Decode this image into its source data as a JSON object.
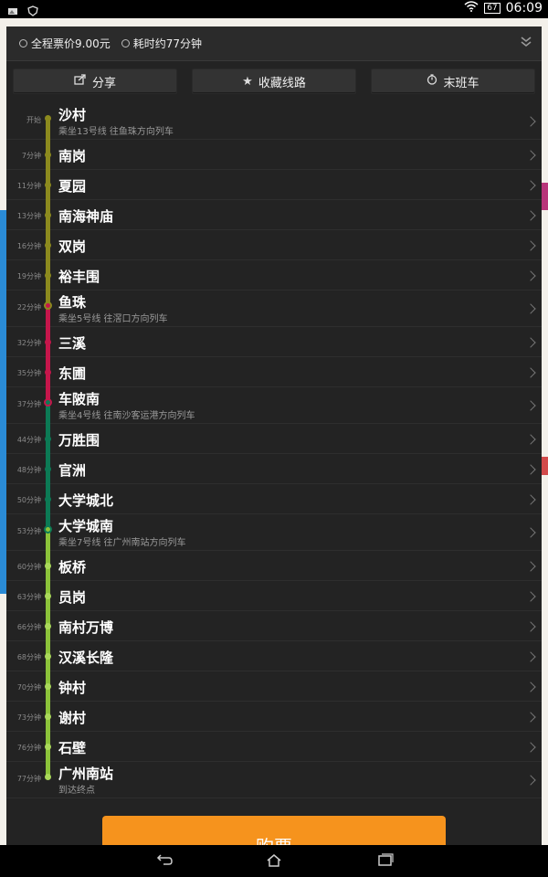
{
  "status": {
    "battery": "67",
    "time": "06:09"
  },
  "summary": {
    "fare": "全程票价9.00元",
    "duration": "耗时约77分钟"
  },
  "actions": [
    {
      "label": "分享"
    },
    {
      "label": "收藏线路"
    },
    {
      "label": "末班车"
    }
  ],
  "stations": [
    {
      "time": "开始",
      "name": "沙村",
      "sub": "乘坐13号线 往鱼珠方向列车"
    },
    {
      "time": "7分钟",
      "name": "南岗"
    },
    {
      "time": "11分钟",
      "name": "夏园"
    },
    {
      "time": "13分钟",
      "name": "南海神庙"
    },
    {
      "time": "16分钟",
      "name": "双岗"
    },
    {
      "time": "19分钟",
      "name": "裕丰围"
    },
    {
      "time": "22分钟",
      "name": "鱼珠",
      "sub": "乘坐5号线 往滘口方向列车"
    },
    {
      "time": "32分钟",
      "name": "三溪"
    },
    {
      "time": "35分钟",
      "name": "东圃"
    },
    {
      "time": "37分钟",
      "name": "车陂南",
      "sub": "乘坐4号线 往南沙客运港方向列车"
    },
    {
      "time": "44分钟",
      "name": "万胜围"
    },
    {
      "time": "48分钟",
      "name": "官洲"
    },
    {
      "time": "50分钟",
      "name": "大学城北"
    },
    {
      "time": "53分钟",
      "name": "大学城南",
      "sub": "乘坐7号线 往广州南站方向列车"
    },
    {
      "time": "60分钟",
      "name": "板桥"
    },
    {
      "time": "63分钟",
      "name": "员岗"
    },
    {
      "time": "66分钟",
      "name": "南村万博"
    },
    {
      "time": "68分钟",
      "name": "汉溪长隆"
    },
    {
      "time": "70分钟",
      "name": "钟村"
    },
    {
      "time": "73分钟",
      "name": "谢村"
    },
    {
      "time": "76分钟",
      "name": "石壁"
    },
    {
      "time": "77分钟",
      "name": "广州南站",
      "sub": "到达终点"
    }
  ],
  "line_colors": {
    "line13": "#8c8a1e",
    "line5": "#c5164b",
    "line4": "#0c7a55",
    "line7": "#8cc33a"
  },
  "buy_label": "购票"
}
